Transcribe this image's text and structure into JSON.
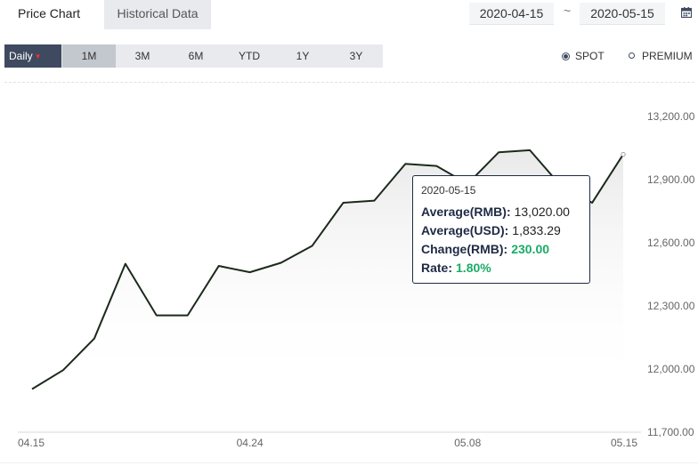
{
  "tabs": {
    "price_chart": "Price Chart",
    "historical_data": "Historical Data"
  },
  "date_range": {
    "start": "2020-04-15",
    "separator": "~",
    "end": "2020-05-15"
  },
  "period": {
    "frequency": "Daily",
    "ranges": [
      "1M",
      "3M",
      "6M",
      "YTD",
      "1Y",
      "3Y"
    ],
    "selected": "1M"
  },
  "price_type": {
    "options": [
      "SPOT",
      "PREMIUM"
    ],
    "selected": "SPOT"
  },
  "tooltip": {
    "date": "2020-05-15",
    "avg_rmb_label": "Average(RMB):",
    "avg_rmb": "13,020.00",
    "avg_usd_label": "Average(USD):",
    "avg_usd": "1,833.29",
    "change_label": "Change(RMB):",
    "change": "230.00",
    "rate_label": "Rate:",
    "rate": "1.80%"
  },
  "colors": {
    "line": "#1b2a1b",
    "positive": "#1aab66",
    "accent": "#3f4a60"
  },
  "icons": {
    "calendar": "calendar-icon",
    "dropdown": "caret-down-icon"
  },
  "chart_data": {
    "type": "area",
    "x": [
      "04.15",
      "04.16",
      "04.17",
      "04.20",
      "04.21",
      "04.22",
      "04.23",
      "04.24",
      "04.27",
      "04.28",
      "04.29",
      "04.30",
      "05.06",
      "05.07",
      "05.08",
      "05.11",
      "05.12",
      "05.13",
      "05.14",
      "05.15"
    ],
    "values": [
      11905,
      11995,
      12145,
      12500,
      12255,
      12255,
      12490,
      12460,
      12505,
      12585,
      12790,
      12800,
      12975,
      12965,
      12880,
      13030,
      13040,
      12870,
      12790,
      13020
    ],
    "x_tick_labels": [
      "04.15",
      "04.24",
      "05.08",
      "05.15"
    ],
    "y_ticks": [
      11700,
      12000,
      12300,
      12600,
      12900,
      13200
    ],
    "y_tick_labels": [
      "11,700.00",
      "12,000.00",
      "12,300.00",
      "12,600.00",
      "12,900.00",
      "13,200.00"
    ],
    "ylim": [
      11700,
      13200
    ],
    "y_axis_position": "right",
    "legend": "none",
    "grid": false
  }
}
